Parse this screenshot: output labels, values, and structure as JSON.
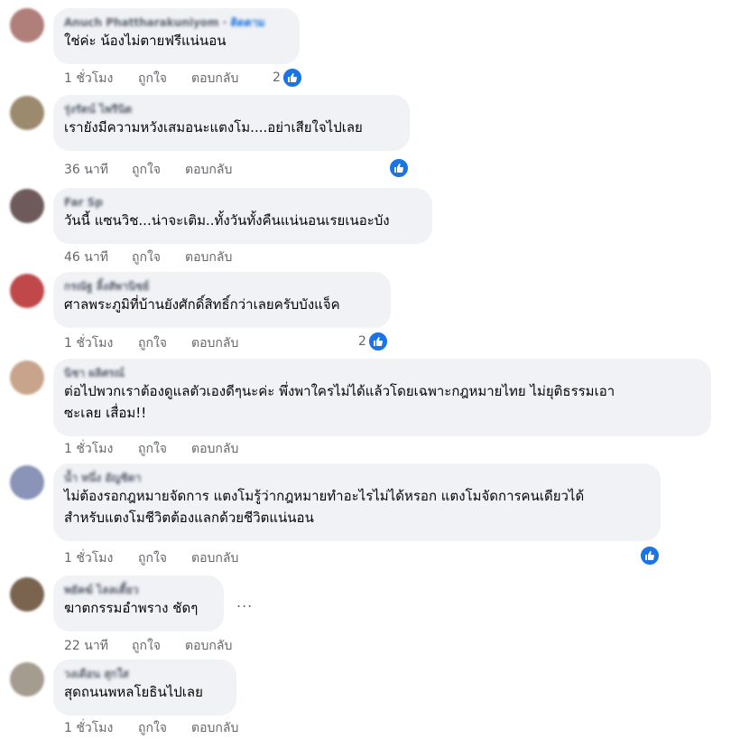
{
  "comments": [
    {
      "name": "Anuch Phattharakuniyom",
      "badge": "ติดตาม",
      "text": [
        "ใช่ค่ะ น้องไม่ตายฟรีแน่นอน"
      ],
      "time": "1 ชั่วโมง",
      "like": "ถูกใจ",
      "reply": "ตอบกลับ",
      "reactions": "2",
      "avatar_color": "#b07f7a"
    },
    {
      "name": "รุ่งรัตน์ ไพรีนิต",
      "text": [
        "เรายังมีความหวังเสมอนะแตงโม....อย่าเสียใจไปเลย"
      ],
      "time": "36 นาที",
      "like": "ถูกใจ",
      "reply": "ตอบกลับ",
      "reactions": "",
      "avatar_color": "#9c8a6e"
    },
    {
      "name": "Far Sp",
      "text": [
        "วันนี้ แซนวิช...น่าจะเติม..ทั้งวันทั้งคืนแน่นอนเรยเนอะบัง"
      ],
      "time": "46 นาที",
      "like": "ถูกใจ",
      "reply": "ตอบกลับ",
      "reactions": "",
      "avatar_color": "#6e5a5a"
    },
    {
      "name": "กรณัฐ ลิ้งสัพานิชย์",
      "text": [
        "ศาลพระภูมิที่บ้านยังศักดิ์สิทธิ์กว่าเลยครับบังแจ็ค"
      ],
      "time": "1 ชั่วโมง",
      "like": "ถูกใจ",
      "reply": "ตอบกลับ",
      "reactions": "2",
      "avatar_color": "#c0484a"
    },
    {
      "name": "นิชา ผลิศรณ์",
      "text": [
        "ต่อไปพวกเราต้องดูแลตัวเองดีๆนะค่ะ พึ่งพาใครไม่ได้แล้วโดยเฉพาะกฎหมายไทย ไม่ยุติธรรมเอา",
        "ซะเลย เสื่อม!!"
      ],
      "time": "1 ชั่วโมง",
      "like": "ถูกใจ",
      "reply": "ตอบกลับ",
      "reactions": "",
      "avatar_color": "#c9a48c"
    },
    {
      "name": "น้ำ หนึ่ง อัญชิดา",
      "text": [
        "ไม่ต้องรอกฎหมายจัดการ แตงโมรู้ว่ากฎหมายทำอะไรไม่ได้หรอก แตงโมจัดการคนเดียวได้",
        "สำหรับแตงโมชีวิตต้องแลกด้วยชีวิตแน่นอน"
      ],
      "time": "1 ชั่วโมง",
      "like": "ถูกใจ",
      "reply": "ตอบกลับ",
      "reactions": "",
      "avatar_color": "#8a94b8"
    },
    {
      "name": "พยัคฆ์ ไลลเตี้ยว",
      "text": [
        "ฆาตกรรมอำพราง ชัดๆ"
      ],
      "time": "22 นาที",
      "like": "ถูกใจ",
      "reply": "ตอบกลับ",
      "reactions": "",
      "avatar_color": "#7a6450"
    },
    {
      "name": "วงเดือน สุกใส",
      "text": [
        "สุดถนนพหลโยธินไปเลย"
      ],
      "time": "1 ชั่วโมง",
      "like": "ถูกใจ",
      "reply": "ตอบกลับ",
      "reactions": "",
      "avatar_color": "#a59c90"
    }
  ],
  "more_label": "...",
  "colors": {
    "bubble": "#f0f2f5",
    "like_blue": "#1b74e4",
    "meta": "#65676b"
  }
}
